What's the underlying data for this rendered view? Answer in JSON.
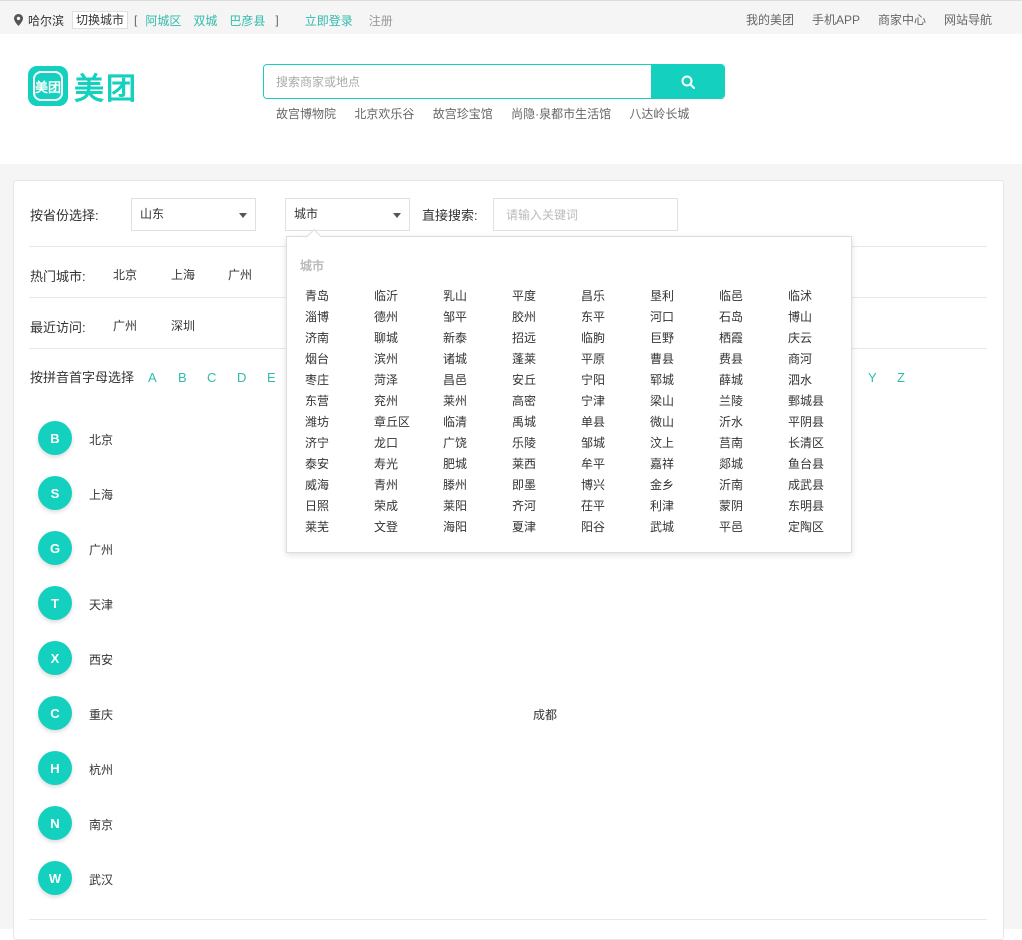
{
  "topbar": {
    "location": "哈尔滨",
    "switch_city": "切换城市",
    "bracket_open": "[",
    "bracket_close": "]",
    "districts": [
      "阿城区",
      "双城",
      "巴彦县"
    ],
    "login": "立即登录",
    "register": "注册",
    "right_links": [
      "我的美团",
      "手机APP",
      "商家中心",
      "网站导航"
    ]
  },
  "logo": {
    "mark": "美团",
    "text": "美团"
  },
  "search": {
    "placeholder": "搜索商家或地点",
    "hotwords": [
      "故宫博物院",
      "北京欢乐谷",
      "故宫珍宝馆",
      "尚隐·泉都市生活馆",
      "八达岭长城"
    ]
  },
  "selector": {
    "province_label": "按省份选择:",
    "province_value": "山东",
    "city_value": "城市",
    "direct_label": "直接搜索:",
    "keyword_placeholder": "请输入关键词"
  },
  "hot": {
    "label": "热门城市:",
    "cities": [
      "北京",
      "上海",
      "广州"
    ]
  },
  "recent": {
    "label": "最近访问:",
    "cities": [
      "广州",
      "深圳"
    ]
  },
  "pinyin": {
    "label": "按拼音首字母选择",
    "letters_left": [
      "A",
      "B",
      "C",
      "D",
      "E"
    ],
    "letters_right": [
      "Y",
      "Z"
    ]
  },
  "groups": [
    {
      "letter": "B",
      "cities": [
        "北京"
      ]
    },
    {
      "letter": "S",
      "cities": [
        "上海"
      ]
    },
    {
      "letter": "G",
      "cities": [
        "广州"
      ]
    },
    {
      "letter": "T",
      "cities": [
        "天津"
      ]
    },
    {
      "letter": "X",
      "cities": [
        "西安"
      ]
    },
    {
      "letter": "C",
      "cities": [
        "重庆",
        "成都"
      ]
    },
    {
      "letter": "H",
      "cities": [
        "杭州"
      ]
    },
    {
      "letter": "N",
      "cities": [
        "南京"
      ]
    },
    {
      "letter": "W",
      "cities": [
        "武汉"
      ]
    }
  ],
  "dropdown": {
    "title": "城市",
    "rows": [
      [
        "青岛",
        "临沂",
        "乳山",
        "平度",
        "昌乐",
        "垦利",
        "临邑",
        "临沭"
      ],
      [
        "淄博",
        "德州",
        "邹平",
        "胶州",
        "东平",
        "河口",
        "石岛",
        "博山"
      ],
      [
        "济南",
        "聊城",
        "新泰",
        "招远",
        "临朐",
        "巨野",
        "栖霞",
        "庆云"
      ],
      [
        "烟台",
        "滨州",
        "诸城",
        "蓬莱",
        "平原",
        "曹县",
        "费县",
        "商河"
      ],
      [
        "枣庄",
        "菏泽",
        "昌邑",
        "安丘",
        "宁阳",
        "郓城",
        "薛城",
        "泗水"
      ],
      [
        "东营",
        "兖州",
        "莱州",
        "高密",
        "宁津",
        "梁山",
        "兰陵",
        "鄄城县"
      ],
      [
        "潍坊",
        "章丘区",
        "临清",
        "禹城",
        "单县",
        "微山",
        "沂水",
        "平阴县"
      ],
      [
        "济宁",
        "龙口",
        "广饶",
        "乐陵",
        "邹城",
        "汶上",
        "莒南",
        "长清区"
      ],
      [
        "泰安",
        "寿光",
        "肥城",
        "莱西",
        "牟平",
        "嘉祥",
        "郯城",
        "鱼台县"
      ],
      [
        "威海",
        "青州",
        "滕州",
        "即墨",
        "博兴",
        "金乡",
        "沂南",
        "成武县"
      ],
      [
        "日照",
        "荣成",
        "莱阳",
        "齐河",
        "茌平",
        "利津",
        "蒙阴",
        "东明县"
      ],
      [
        "莱芜",
        "文登",
        "海阳",
        "夏津",
        "阳谷",
        "武城",
        "平邑",
        "定陶区"
      ]
    ]
  }
}
